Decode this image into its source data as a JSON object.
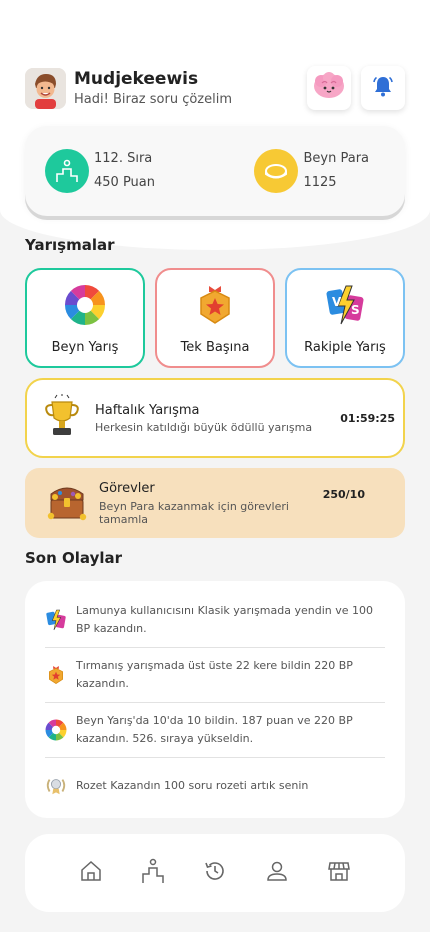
{
  "header": {
    "username": "Mudjekeewis",
    "subtitle": "Hadi! Biraz soru çözelim"
  },
  "stats": {
    "rank": "112. Sıra",
    "points": "450 Puan",
    "currency_label": "Beyn Para",
    "currency_value": "1125"
  },
  "competitions": {
    "title": "Yarışmalar",
    "items": [
      {
        "label": "Beyn Yarış",
        "color": "#1ec99c"
      },
      {
        "label": "Tek Başına",
        "color": "#f08d8d"
      },
      {
        "label": "Rakiple Yarış",
        "color": "#7cc2f2"
      }
    ]
  },
  "weekly": {
    "title": "Haftalık Yarışma",
    "subtitle": "Herkesin katıldığı büyük ödüllü yarışma",
    "timer": "01:59:25"
  },
  "tasks": {
    "title": "Görevler",
    "subtitle": "Beyn Para kazanmak için görevleri tamamla",
    "count": "250/10"
  },
  "events": {
    "title": "Son Olaylar",
    "items": [
      {
        "text": "Lamunya kullanıcısını Klasik yarışmada yendin ve 100 BP kazandın.",
        "icon": "vs-icon"
      },
      {
        "text": "Tırmanış yarışmada üst üste 22 kere bildin 220 BP kazandın.",
        "icon": "star-badge-icon"
      },
      {
        "text": "Beyn Yarış'da 10'da 10 bildin. 187 puan ve 220 BP kazandın. 526. sıraya yükseldin.",
        "icon": "color-wheel-icon"
      },
      {
        "text": "Rozet Kazandın 100 soru rozeti artık senin",
        "icon": "laurel-badge-icon"
      }
    ]
  },
  "colors": {
    "accent_green": "#1ec99c",
    "accent_yellow": "#f7c934",
    "weekly_border": "#f2d34c",
    "tasks_bg": "#f7e0bd"
  }
}
